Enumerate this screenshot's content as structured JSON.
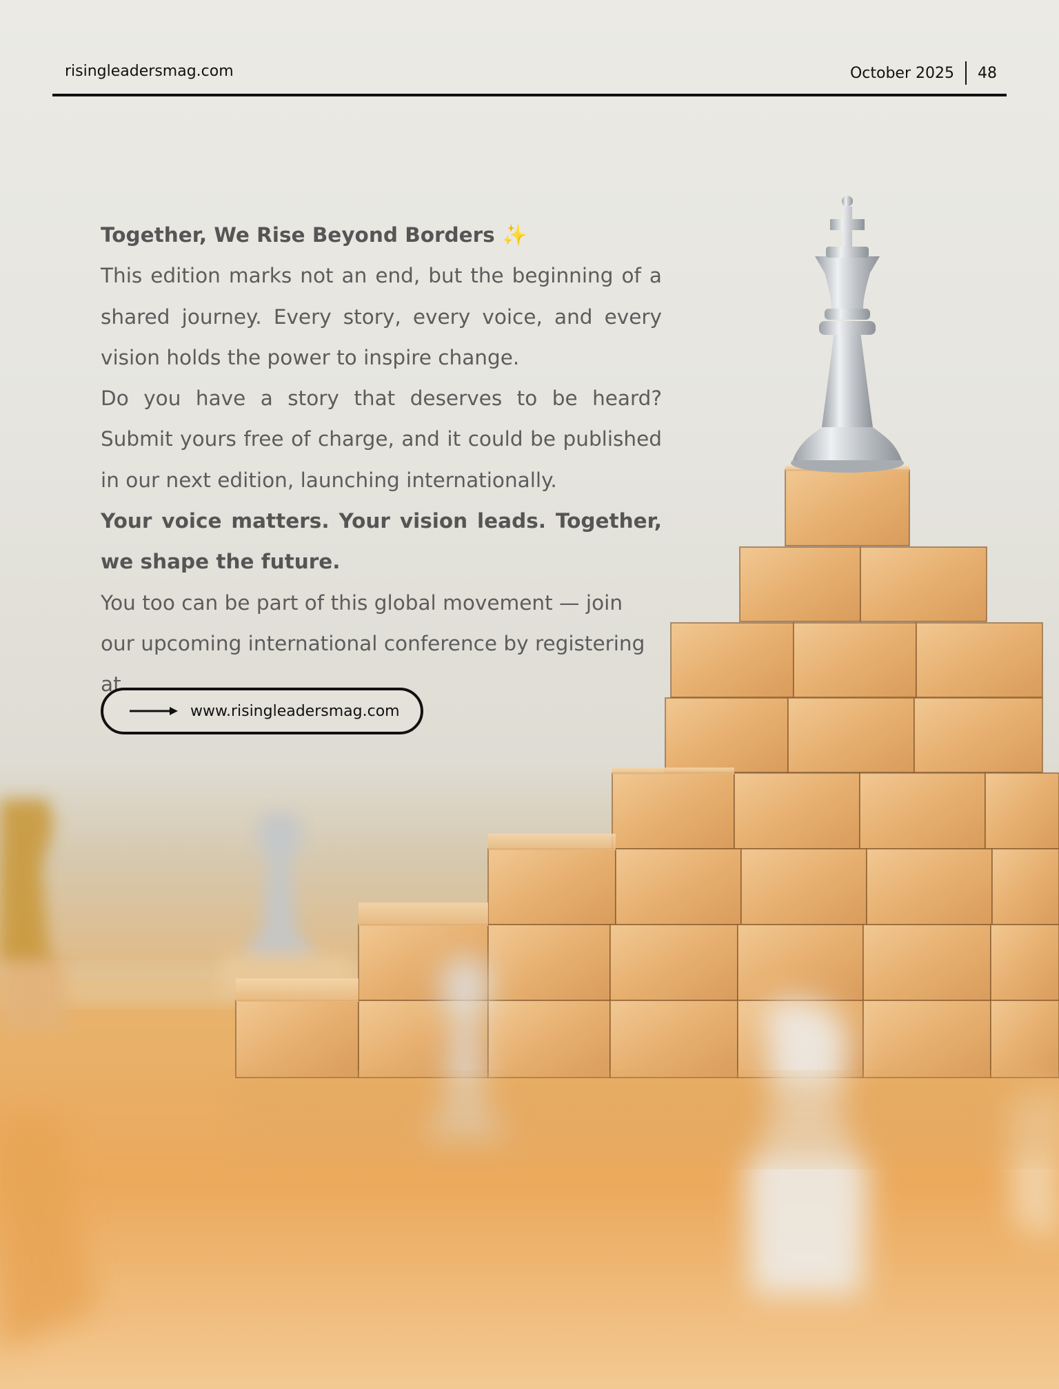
{
  "header": {
    "site": "risingleadersmag.com",
    "date": "October 2025",
    "page_number": "48"
  },
  "article": {
    "heading": "Together, We Rise Beyond Borders",
    "paragraph1": "This edition marks not an end, but the beginning of a shared journey. Every story, every voice, and every vision holds the power to inspire change.",
    "paragraph2": "Do you have a story that deserves to be heard? Submit yours free of charge, and it could be published in our next edition, launching internationally.",
    "tagline": "Your voice matters. Your vision leads. Together, we shape the future.",
    "paragraph3": "You too can be part of this global movement — join our upcoming international conference by registering at"
  },
  "cta": {
    "url_label": "www.risingleadersmag.com"
  },
  "icons": {
    "heading_icon": "sparkles-icon",
    "cta_icon": "arrow-right-icon"
  },
  "colors": {
    "text": "#5c5c5c",
    "rule": "#111111",
    "sparkle": "#f2b331",
    "wood": "#e7b57a"
  }
}
